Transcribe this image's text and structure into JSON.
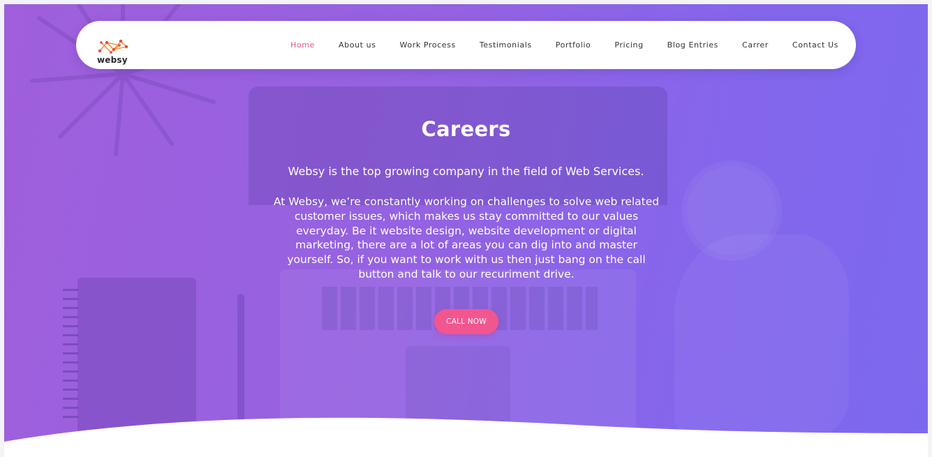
{
  "brand": {
    "name": "websy"
  },
  "nav": {
    "items": [
      {
        "label": "Home",
        "active": true
      },
      {
        "label": "About us",
        "active": false
      },
      {
        "label": "Work Process",
        "active": false
      },
      {
        "label": "Testimonials",
        "active": false
      },
      {
        "label": "Portfolio",
        "active": false
      },
      {
        "label": "Pricing",
        "active": false
      },
      {
        "label": "Blog Entries",
        "active": false
      },
      {
        "label": "Carrer",
        "active": false
      },
      {
        "label": "Contact Us",
        "active": false
      }
    ]
  },
  "hero": {
    "title": "Careers",
    "subtitle": "Websy is the top growing company in the field of Web Services.",
    "body": "At Websy, we’re constantly working on challenges to solve web related customer issues, which makes us stay committed to our values everyday. Be it website design, website development or digital marketing, there are a lot of areas you can dig into and master yourself. So, if you want to work with us then just bang on the call button and talk to our recuriment drive.",
    "cta_label": "CALL NOW"
  },
  "colors": {
    "accent": "#f0508a",
    "gradient_start": "#a05fdc",
    "gradient_end": "#7c68ee",
    "logo_orange": "#f2994a",
    "logo_red": "#e84a3c"
  },
  "icons": {
    "logo": "network-nodes-logo-icon"
  }
}
